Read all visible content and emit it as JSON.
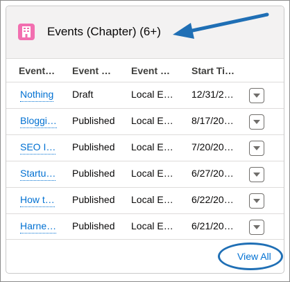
{
  "header": {
    "title": "Events (Chapter) (6+)",
    "icon": "building-icon",
    "icon_color": "#f26fb0"
  },
  "columns": [
    "Event…",
    "Event …",
    "Event …",
    "Start Ti…"
  ],
  "rows": [
    {
      "name": "Nothing",
      "status": "Draft",
      "type": "Local E…",
      "start": "12/31/2…"
    },
    {
      "name": "Bloggi…",
      "status": "Published",
      "type": "Local E…",
      "start": "8/17/20…"
    },
    {
      "name": "SEO I…",
      "status": "Published",
      "type": "Local E…",
      "start": "7/20/20…"
    },
    {
      "name": "Startu…",
      "status": "Published",
      "type": "Local E…",
      "start": "6/27/20…"
    },
    {
      "name": "How t…",
      "status": "Published",
      "type": "Local E…",
      "start": "6/22/20…"
    },
    {
      "name": "Harne…",
      "status": "Published",
      "type": "Local E…",
      "start": "6/21/20…"
    }
  ],
  "footer": {
    "view_all": "View All"
  },
  "colors": {
    "link": "#0070d2",
    "annotation": "#1f6fb5"
  }
}
